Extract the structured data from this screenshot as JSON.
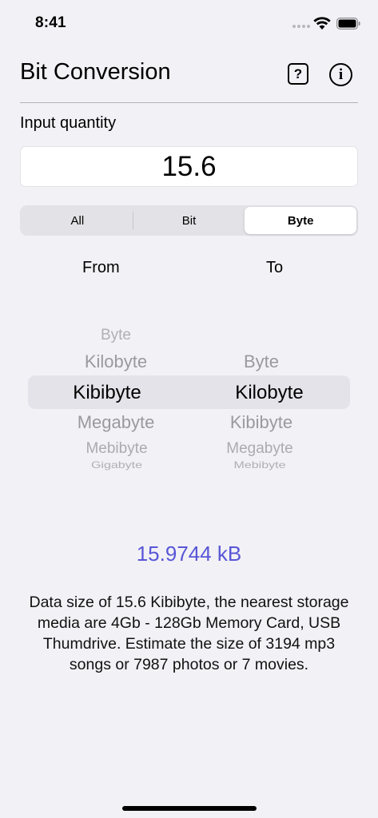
{
  "status_bar": {
    "time": "8:41"
  },
  "header": {
    "title": "Bit Conversion",
    "help_icon_glyph": "?",
    "info_icon_glyph": "i"
  },
  "input": {
    "label": "Input quantity",
    "value": "15.6"
  },
  "segments": {
    "items": [
      "All",
      "Bit",
      "Byte"
    ],
    "selected": "Byte"
  },
  "columns": {
    "from_label": "From",
    "to_label": "To"
  },
  "picker": {
    "from": {
      "above": [
        "Byte",
        "Kilobyte"
      ],
      "selected": "Kibibyte",
      "below": [
        "Megabyte",
        "Mebibyte",
        "Gigabyte"
      ]
    },
    "to": {
      "above": [
        "Byte"
      ],
      "selected": "Kilobyte",
      "below": [
        "Kibibyte",
        "Megabyte",
        "Mebibyte"
      ]
    }
  },
  "result": {
    "value": "15.9744 kB",
    "description": "Data size of 15.6 Kibibyte, the nearest storage media are 4Gb - 128Gb Memory Card, USB Thumdrive. Estimate the size of 3194 mp3 songs or 7987 photos or 7 movies."
  },
  "colors": {
    "accent": "#5856d6",
    "background": "#f2f1f6"
  }
}
